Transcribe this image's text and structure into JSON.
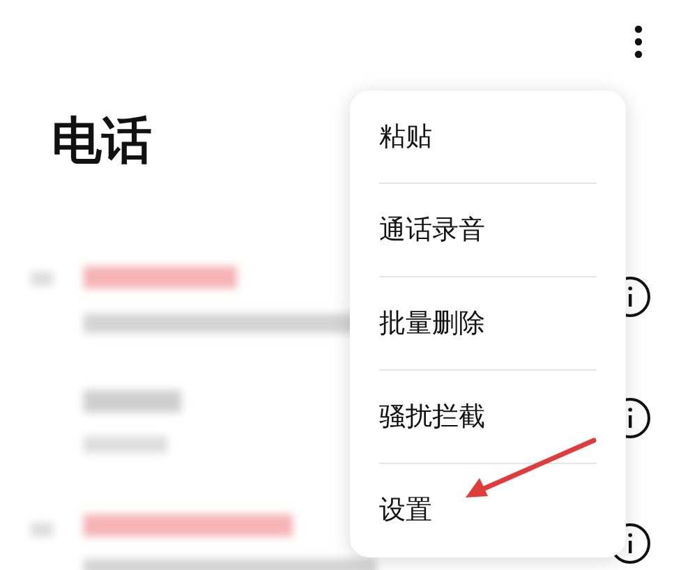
{
  "header": {
    "title": "电话"
  },
  "menu": {
    "items": [
      {
        "label": "粘贴"
      },
      {
        "label": "通话录音"
      },
      {
        "label": "批量删除"
      },
      {
        "label": "骚扰拦截"
      },
      {
        "label": "设置"
      }
    ]
  }
}
